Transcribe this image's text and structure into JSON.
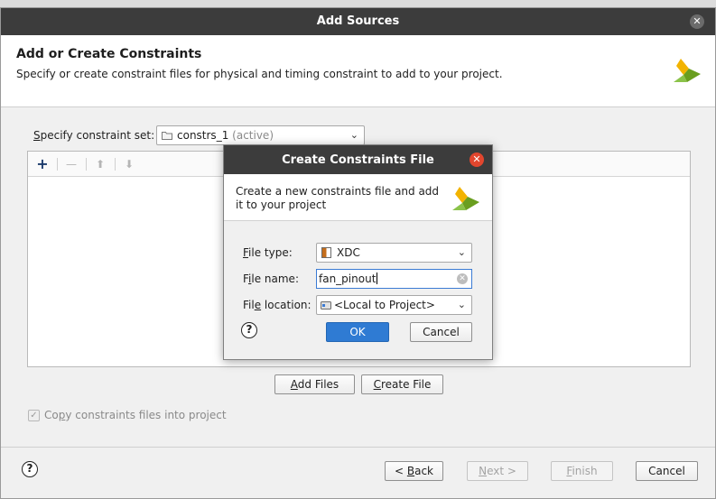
{
  "window": {
    "title": "Add Sources"
  },
  "header": {
    "title": "Add or Create Constraints",
    "description": "Specify or create constraint files for physical and timing constraint to add to your project."
  },
  "constraint_set": {
    "label_accel": "S",
    "label_rest": "pecify constraint set:",
    "name": "constrs_1",
    "suffix": "(active)"
  },
  "toolbar": {
    "add": "+",
    "remove": "—",
    "up": "⬆",
    "down": "⬇"
  },
  "list_actions": {
    "add_files_accel": "A",
    "add_files_rest": "dd Files",
    "create_file_accel": "C",
    "create_file_rest": "reate File"
  },
  "copy_option": {
    "pre": "Co",
    "accel": "p",
    "post": "y constraints files into project",
    "checked": true
  },
  "footer": {
    "help": "?",
    "back_pre": "< ",
    "back_accel": "B",
    "back_post": "ack",
    "next_accel": "N",
    "next_post": "ext >",
    "finish_accel": "F",
    "finish_post": "inish",
    "cancel": "Cancel"
  },
  "create_dialog": {
    "title": "Create Constraints File",
    "description": "Create a new constraints file and add it to your project",
    "file_type_label_accel": "F",
    "file_type_label_rest": "ile type:",
    "file_type_value": "XDC",
    "file_name_label_pre": "F",
    "file_name_label_accel": "i",
    "file_name_label_rest": "le name:",
    "file_name_value": "fan_pinout",
    "file_location_label_pre": "Fil",
    "file_location_label_accel": "e",
    "file_location_label_rest": " location:",
    "file_location_value": "<Local to Project>",
    "help": "?",
    "ok": "OK",
    "cancel": "Cancel"
  },
  "colors": {
    "titlebar": "#3c3c3c",
    "accent": "#2f7bd3",
    "close_red": "#e2462e",
    "logo_yellow": "#f2b300",
    "logo_green": "#6a9e1f"
  }
}
